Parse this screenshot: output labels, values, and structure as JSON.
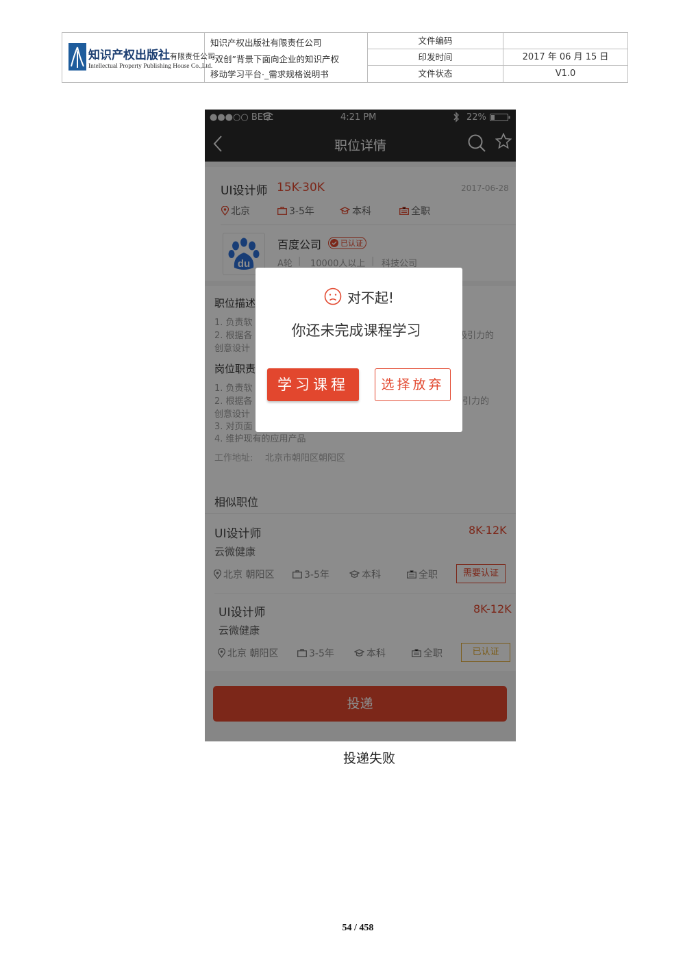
{
  "header": {
    "logo_cn": "知识产权出版社",
    "logo_cn_suffix": "有限责任公司",
    "logo_en": "Intellectual Property Publishing House Co.,Ltd.",
    "publisher_line1": "知识产权出版社有限责任公司",
    "publisher_line2": "“双创”背景下面向企业的知识产权",
    "publisher_line3": "移动学习平台·_需求规格说明书",
    "label_code": "文件编码",
    "value_code": "",
    "label_date": "印发时间",
    "value_date": "2017 年 06 月 15 日",
    "label_status": "文件状态",
    "value_status": "V1.0"
  },
  "phone": {
    "status": {
      "carrier": "●●●○○ BELL",
      "time": "4:21 PM",
      "battery": "22%"
    },
    "nav_title": "职位详情",
    "job": {
      "title": "UI设计师",
      "salary": "15K-30K",
      "date": "2017-06-28",
      "city": "北京",
      "exp": "3-5年",
      "edu": "本科",
      "type": "全职"
    },
    "company": {
      "logo_text": "du",
      "name": "百度公司",
      "badge": "已认证",
      "round": "A轮",
      "size": "10000人以上",
      "industry": "科技公司"
    },
    "description": {
      "heading": "职位描述",
      "line1": "1. 负责软",
      "line2": "2. 根据各",
      "line2_tail": "吸引力的",
      "line3": "创意设计"
    },
    "duties": {
      "heading": "岗位职责",
      "line1": "1. 负责软",
      "line2": "2. 根据各",
      "line2_tail": "引力的",
      "line3": "创意设计",
      "line4": "3. 对页面",
      "line5": "4. 维护现有的应用产品",
      "address_label": "工作地址:",
      "address": "北京市朝阳区朝阳区"
    },
    "similar": {
      "heading": "相似职位",
      "items": [
        {
          "title": "UI设计师",
          "salary": "8K-12K",
          "company": "云微健康",
          "location": "北京 朝阳区",
          "exp": "3-5年",
          "edu": "本科",
          "type": "全职",
          "badge": "需要认证"
        },
        {
          "title": "UI设计师",
          "salary": "8K-12K",
          "company": "云微健康",
          "location": "北京 朝阳区",
          "exp": "3-5年",
          "edu": "本科",
          "type": "全职",
          "badge": "已认证"
        }
      ]
    },
    "submit_label": "投递"
  },
  "dialog": {
    "sorry": "对不起!",
    "message": "你还未完成课程学习",
    "primary_label": "学习课程",
    "secondary_label": "选择放弃"
  },
  "caption": "投递失败",
  "page_number": "54 / 458",
  "colors": {
    "accent": "#e2472e",
    "dark_bar": "#2b2b2b",
    "gold_badge": "#e0a82e"
  }
}
